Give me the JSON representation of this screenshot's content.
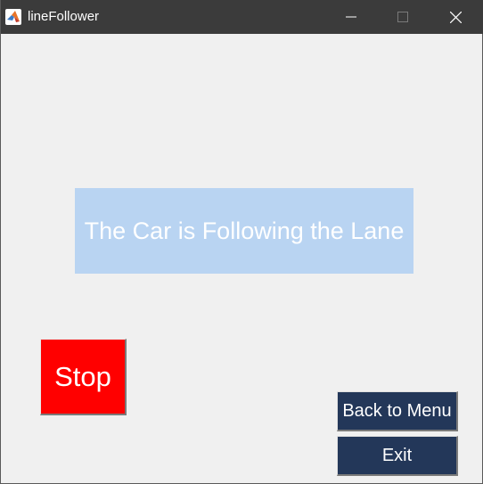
{
  "window": {
    "title": "lineFollower",
    "app_icon": "matlab-icon"
  },
  "title_controls": {
    "minimize_icon": "minimize-icon",
    "maximize_icon": "maximize-icon",
    "close_icon": "close-icon"
  },
  "status": {
    "text": "The Car is Following the Lane",
    "background": "#b9d4f2"
  },
  "buttons": {
    "stop": {
      "label": "Stop",
      "color": "#ff0000"
    },
    "back_to_menu": {
      "label": "Back to Menu",
      "color": "#233759"
    },
    "exit": {
      "label": "Exit",
      "color": "#233759"
    }
  }
}
